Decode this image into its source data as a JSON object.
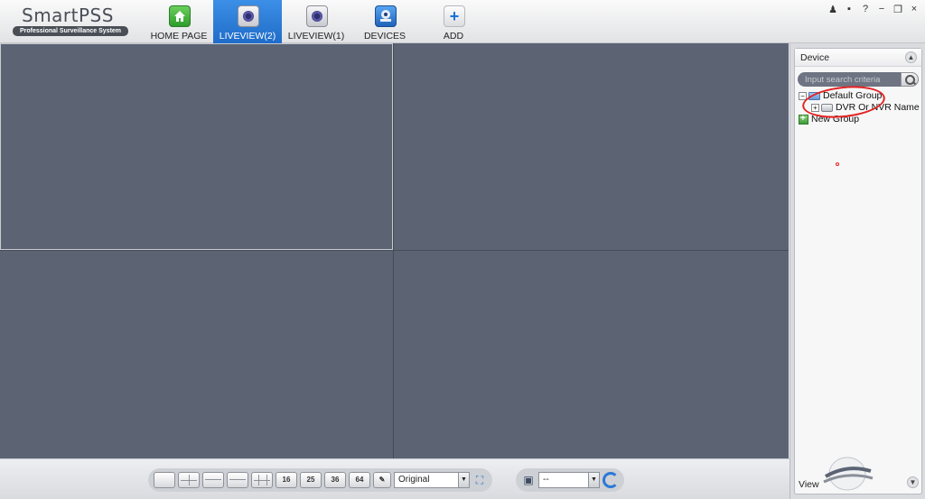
{
  "app": {
    "logo_main": "SmartPSS",
    "logo_sub": "Professional Surveillance System"
  },
  "nav": {
    "items": [
      {
        "label": "HOME PAGE",
        "icon": "home-icon",
        "active": false
      },
      {
        "label": "LIVEVIEW(2)",
        "icon": "camera-icon",
        "active": true
      },
      {
        "label": "LIVEVIEW(1)",
        "icon": "camera-icon",
        "active": false
      },
      {
        "label": "DEVICES",
        "icon": "devices-icon",
        "active": false
      },
      {
        "label": "ADD",
        "icon": "plus-icon",
        "active": false
      }
    ]
  },
  "window_controls": {
    "user": "♟",
    "lock": "▪",
    "help": "?",
    "minimize": "−",
    "restore": "❐",
    "close": "×"
  },
  "toolbar": {
    "split_16": "16",
    "split_25": "25",
    "split_36": "36",
    "split_64": "64",
    "aspect_value": "Original",
    "preset_value": "--"
  },
  "panel": {
    "title": "Device",
    "search_placeholder": "Input search criteria",
    "tree": {
      "default_group": "Default Group",
      "device": "DVR Or NVR Name",
      "new_group": "New Group"
    },
    "footer": "View"
  },
  "colors": {
    "accent": "#1f6cc9",
    "video_bg": "#5c6474",
    "annotation": "#e32222"
  }
}
